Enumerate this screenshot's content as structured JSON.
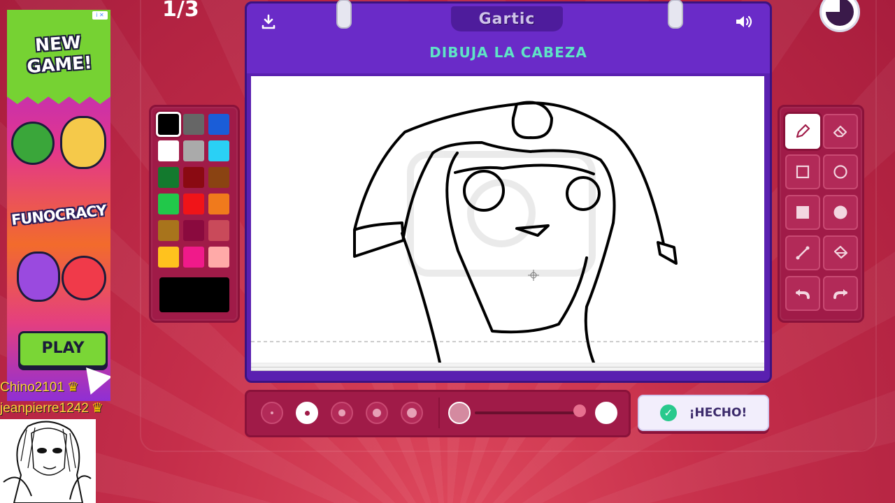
{
  "round_counter": "1/3",
  "header": {
    "logo_text": "Gartic",
    "prompt": "DIBUJA LA CABEZA"
  },
  "ad": {
    "badge": "i ✕",
    "headline": "NEW GAME!",
    "game_name": "FUNOCRACY",
    "play_label": "PLAY"
  },
  "overlay_names": [
    {
      "text": "Chino2101",
      "crown": "♛"
    },
    {
      "text": "jeanpierre1242",
      "crown": "♛"
    }
  ],
  "palette": {
    "colors": [
      "#000000",
      "#666666",
      "#1a5dd8",
      "#ffffff",
      "#aaaaaa",
      "#2ad0f5",
      "#137a2e",
      "#8a0a12",
      "#8a4312",
      "#21c84a",
      "#f01418",
      "#f07a1c",
      "#a8741c",
      "#8a0a3e",
      "#c94a5a",
      "#ffc21e",
      "#f01a8a",
      "#ffaaa8"
    ],
    "selected_index": 0,
    "current_color": "#000000"
  },
  "tools": [
    {
      "name": "pencil",
      "icon": "pencil-icon",
      "selected": true
    },
    {
      "name": "eraser",
      "icon": "eraser-icon",
      "selected": false
    },
    {
      "name": "rectangle-outline",
      "icon": "square-outline-icon",
      "selected": false
    },
    {
      "name": "ellipse-outline",
      "icon": "circle-outline-icon",
      "selected": false
    },
    {
      "name": "rectangle-filled",
      "icon": "square-filled-icon",
      "selected": false
    },
    {
      "name": "ellipse-filled",
      "icon": "circle-filled-icon",
      "selected": false
    },
    {
      "name": "line",
      "icon": "line-icon",
      "selected": false
    },
    {
      "name": "fill",
      "icon": "bucket-icon",
      "selected": false
    },
    {
      "name": "undo",
      "icon": "undo-icon",
      "selected": false
    },
    {
      "name": "redo",
      "icon": "redo-icon",
      "selected": false
    }
  ],
  "brush_sizes": {
    "options": [
      1,
      2,
      3,
      4,
      5
    ],
    "selected_index": 1
  },
  "opacity_level": 1.0,
  "done_button": "¡HECHO!",
  "accent_colors": {
    "purple": "#6a2bc8",
    "teal": "#5fe3c6",
    "panel": "#a01b48"
  }
}
